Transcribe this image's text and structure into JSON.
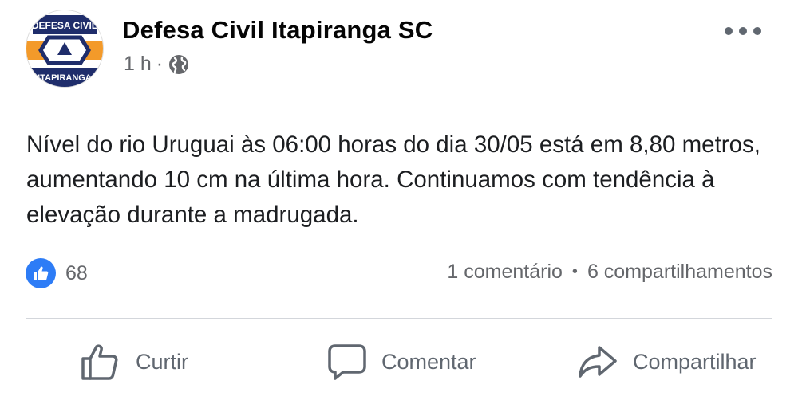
{
  "post": {
    "page_name": "Defesa Civil Itapiranga SC",
    "time": "1 h",
    "meta_separator": "·",
    "privacy_icon": "globe-icon",
    "body": "Nível do rio Uruguai às 06:00 horas do dia 30/05 está em 8,80 metros, aumentando 10 cm na última hora. Continuamos com tendência à elevação durante a madrugada.",
    "avatar": {
      "top_text": "DEFESA CIVIL",
      "bottom_text": "ITAPIRANGA",
      "colors": {
        "navy": "#1f2d6b",
        "orange": "#f39a2a"
      }
    }
  },
  "stats": {
    "reaction_icon": "like-icon",
    "reaction_count": "68",
    "comments": "1 comentário",
    "dot": "•",
    "shares": "6 compartilhamentos"
  },
  "actions": {
    "like": {
      "label": "Curtir",
      "icon": "thumbs-up-icon"
    },
    "comment": {
      "label": "Comentar",
      "icon": "speech-bubble-icon"
    },
    "share": {
      "label": "Compartilhar",
      "icon": "share-arrow-icon"
    }
  },
  "colors": {
    "accent_blue": "#2d7cf6",
    "secondary_text": "#65676b",
    "primary_text": "#1c1e21"
  }
}
